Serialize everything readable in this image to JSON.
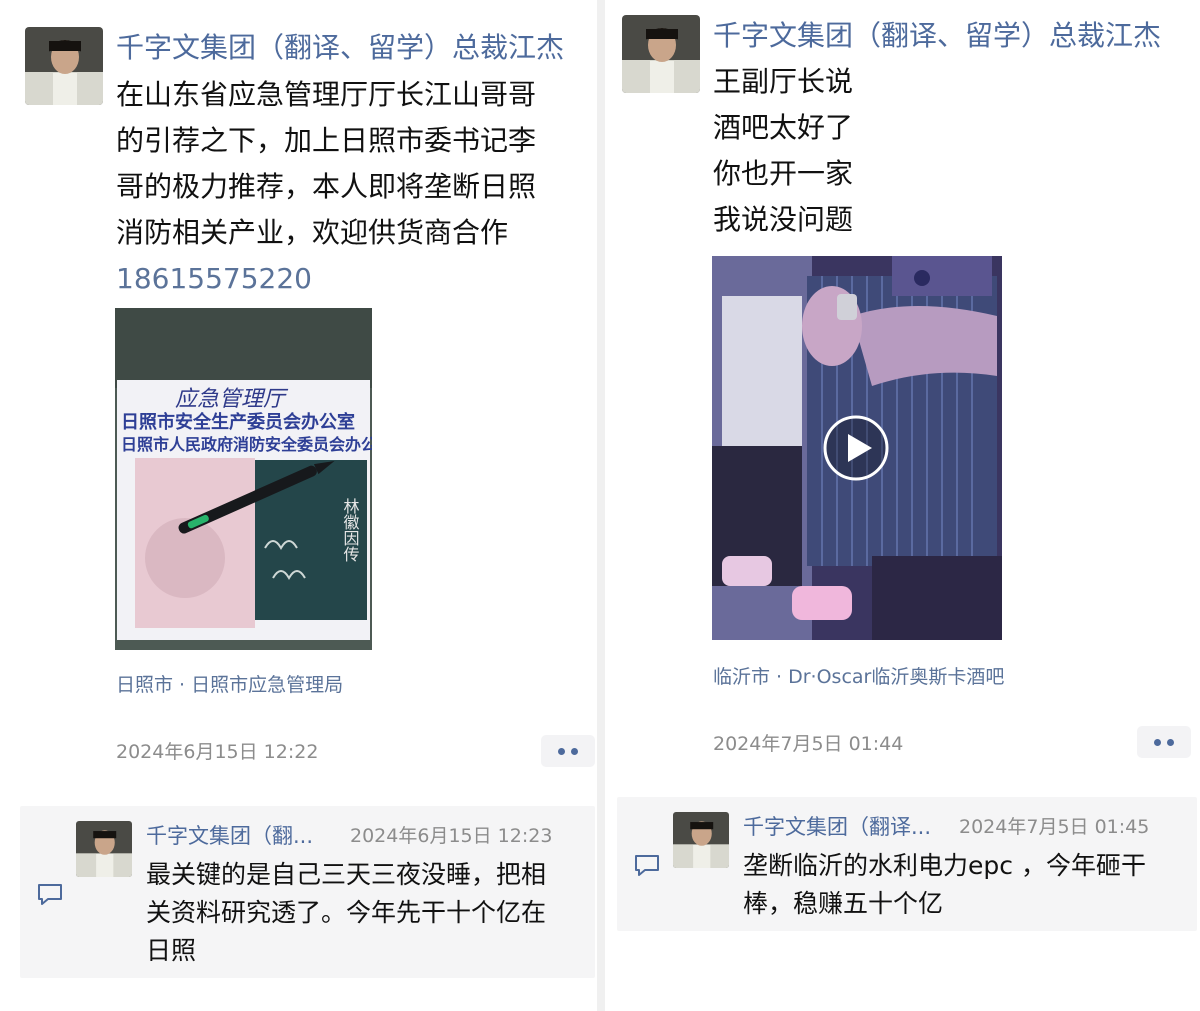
{
  "colors": {
    "name_link": "#4d6a9c",
    "timestamp": "#8c8c8c",
    "comment_bg": "#f5f5f6"
  },
  "left_post": {
    "author": "千字文集团（翻译、留学）总裁江杰",
    "text_lines": [
      "在山东省应急管理厅厅长江山哥哥",
      "的引荐之下，加上日照市委书记李",
      "哥的极力推荐，本人即将垄断日照",
      "消防相关产业，欢迎供货商合作"
    ],
    "phone": "18615575220",
    "photo": {
      "handwriting": "应急管理厅",
      "letterhead_line1": "日照市安全生产委员会办公室",
      "letterhead_line2": "日照市人民政府消防安全委员会办公室",
      "book_title": "林徽因传"
    },
    "location": "日照市 · 日照市应急管理局",
    "timestamp": "2024年6月15日 12:22",
    "comment": {
      "author": "千字文集团（翻...",
      "time": "2024年6月15日 12:23",
      "text_lines": [
        "最关键的是自己三天三夜没睡，把相",
        "关资料研究透了。今年先干十个亿在",
        "日照"
      ]
    }
  },
  "right_post": {
    "author": "千字文集团（翻译、留学）总裁江杰",
    "text_lines": [
      "王副厅长说",
      "酒吧太好了",
      "你也开一家",
      "我说没问题"
    ],
    "location": "临沂市 · Dr·Oscar临沂奥斯卡酒吧",
    "timestamp": "2024年7月5日 01:44",
    "comment": {
      "author": "千字文集团（翻译...",
      "time": "2024年7月5日 01:45",
      "text_lines": [
        "垄断临沂的水利电力epc ，今年砸干",
        "棒，稳赚五十个亿"
      ]
    }
  },
  "icons": {
    "more": "more-dots-icon",
    "comment": "comment-bubble-icon",
    "play": "play-icon"
  }
}
